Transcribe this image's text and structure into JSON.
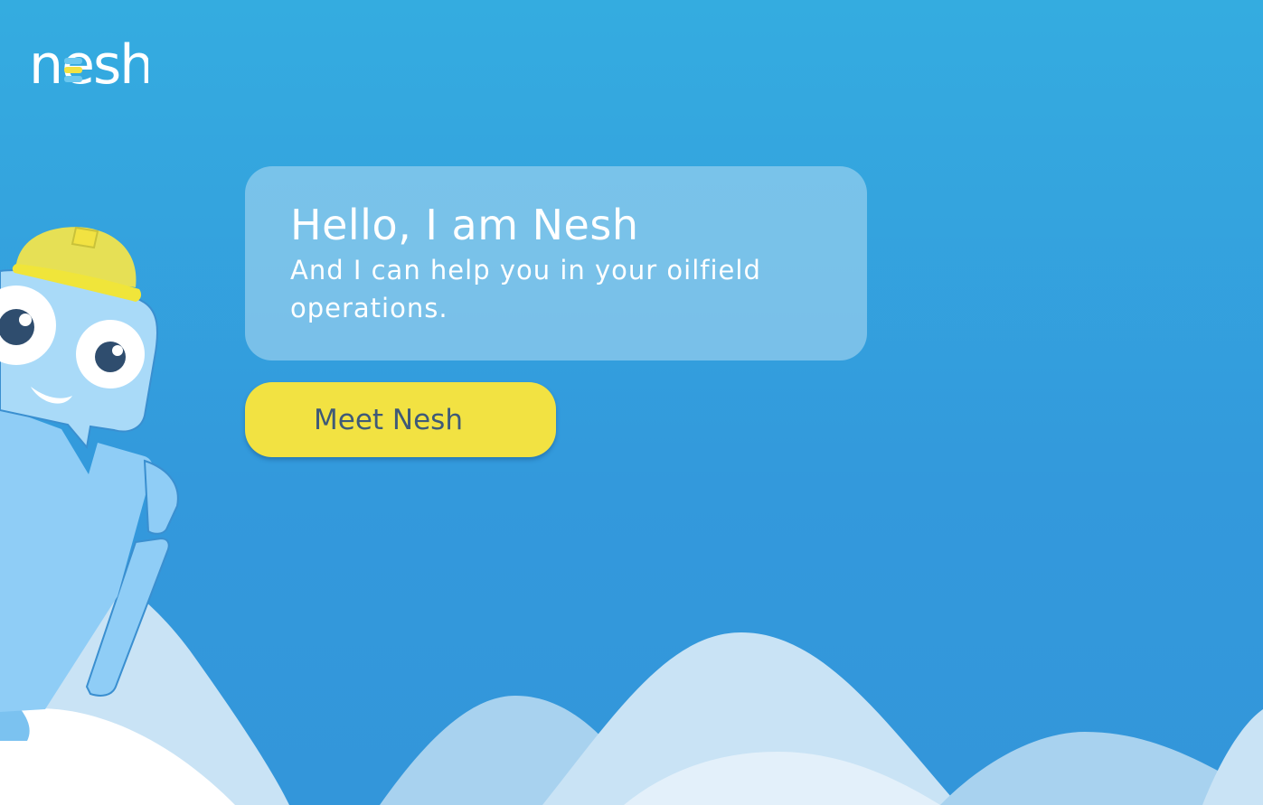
{
  "brand": {
    "logo_text": "nesh",
    "logo_color": "#ffffff",
    "logo_accent_colors": [
      "#6cc8f0",
      "#f2e242"
    ]
  },
  "hero": {
    "greeting": "Hello, I am Nesh",
    "subtitle": "And I can help you in your oilfield operations.",
    "cta_label": "Meet Nesh"
  },
  "colors": {
    "background_top": "#34ace0",
    "background_bottom": "#3396da",
    "cta_background": "#f2e242",
    "cta_text": "#3f5a78",
    "bubble_background": "#a5d5f0",
    "robot_body": "#8fcdf6",
    "helmet": "#e6e055"
  },
  "icons": {
    "mascot": "robot-mascot-with-hard-hat",
    "logo": "nesh-logo"
  }
}
